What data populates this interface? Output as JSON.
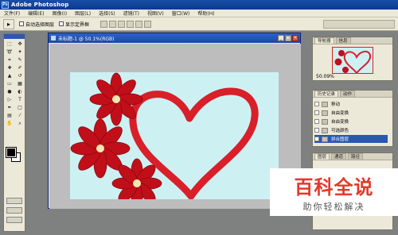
{
  "app": {
    "title": "Adobe Photoshop"
  },
  "menu": [
    "文件(F)",
    "编辑(E)",
    "图像(I)",
    "图层(L)",
    "选择(S)",
    "滤镜(T)",
    "视图(V)",
    "窗口(W)",
    "帮助(H)"
  ],
  "options": {
    "auto_select": "自动选择图层",
    "show_bounds": "显示定界框"
  },
  "document": {
    "title": "未标题-1 @ 50.1%(RGB)"
  },
  "navigator": {
    "tabs": [
      "导航器",
      "信息"
    ],
    "zoom": "50.09%"
  },
  "history": {
    "tabs": [
      "历史记录",
      "动作"
    ],
    "items": [
      {
        "label": "移动",
        "selected": false
      },
      {
        "label": "自由变换",
        "selected": false
      },
      {
        "label": "自由变换",
        "selected": false
      },
      {
        "label": "可选颜色",
        "selected": false
      },
      {
        "label": "拼合图层",
        "selected": true
      }
    ]
  },
  "layers": {
    "tabs": [
      "图层",
      "通道",
      "路径"
    ]
  },
  "watermark": {
    "title": "百科全说",
    "subtitle": "助你轻松解决"
  },
  "colors": {
    "canvas": "#cdf1f3",
    "heart": "#d91f2a",
    "flower": "#c10f1a",
    "title_bar": "#0b3a90"
  }
}
